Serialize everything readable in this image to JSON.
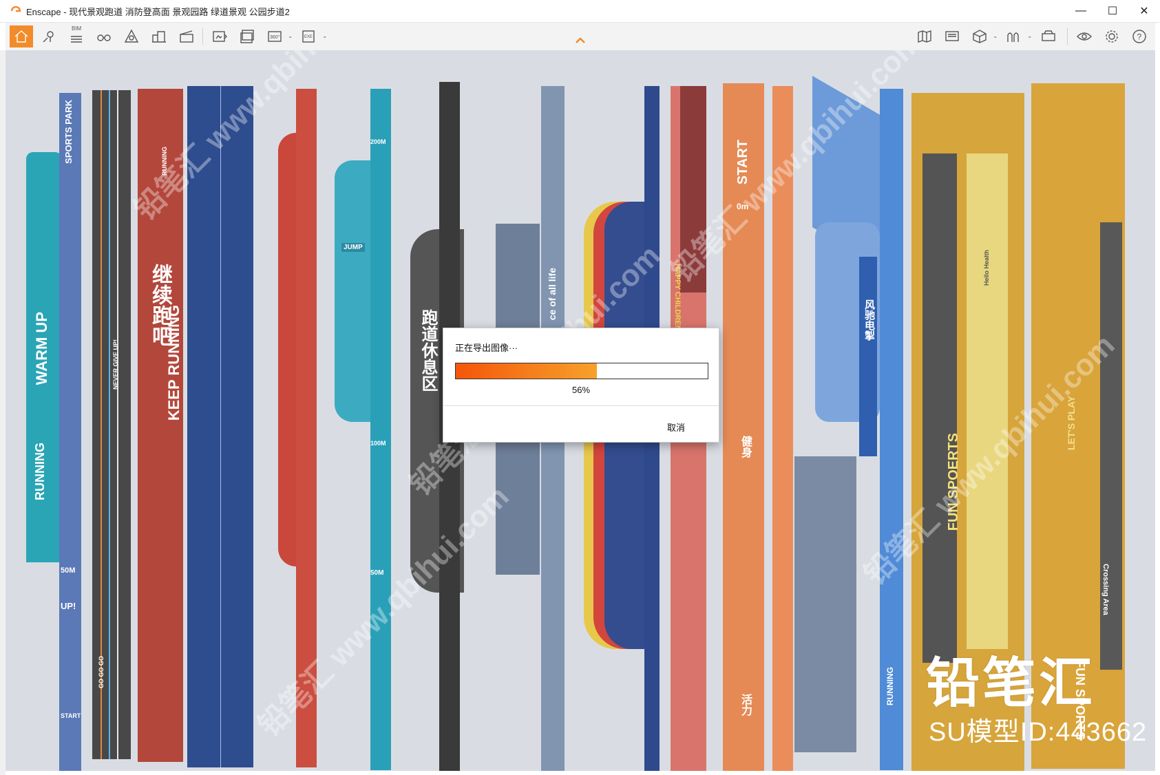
{
  "window": {
    "app_name": "Enscape",
    "title": "Enscape - 现代景观跑道 消防登高面 景观园路 绿道景观 公园步道2",
    "minimize": "—",
    "maximize": "☐",
    "close": "✕"
  },
  "toolbar": {
    "bim_label": "BIM",
    "panorama_label": "360°",
    "exe_label": "EXE",
    "help_label": "?"
  },
  "viewport": {
    "track_texts": {
      "sports_park": "SPORTS PARK",
      "warm_up": "WARM UP",
      "running": "RUNNING",
      "marker_50m": "50M",
      "marker_up": "UP!",
      "marker_start": "START",
      "never_give_up": "NEVER GIVE UP!",
      "go_go_go": "GO GO GO",
      "keep_running_cn": "继续跑吧",
      "keep_running_en": "KEEP RUNNING",
      "running_small": "RUNNING",
      "marker_200m": "200M",
      "jump": "JUMP",
      "marker_100m": "100M",
      "marker_50m_b": "50M",
      "rest_zone": "跑道休息区",
      "grace_of_life": "ce of all life",
      "happy_children": "HAPPY CHILDREN",
      "start_big": "START",
      "marker_0m": "0m",
      "fitness": "健身",
      "vitality": "活力",
      "wind_runner": "风驰电掣",
      "running_blue": "RUNNING",
      "fun_sports": "FUN SPOERTS",
      "lets_play": "LET'S PLAY",
      "fun_sports_2": "FUN SPORTS",
      "crossing_area": "Crossing Area",
      "hello_health": "Hello Health"
    },
    "watermark": "铅笔汇 www.qbihui.com",
    "brand": "铅笔汇",
    "brand_id": "SU模型ID:443662"
  },
  "dialog": {
    "title": "正在导出图像···",
    "progress": 0.56,
    "progress_text": "56%",
    "cancel_label": "取消"
  },
  "colors": {
    "accent": "#f28b29",
    "progress_start": "#f5560a",
    "progress_end": "#f7a12a"
  }
}
